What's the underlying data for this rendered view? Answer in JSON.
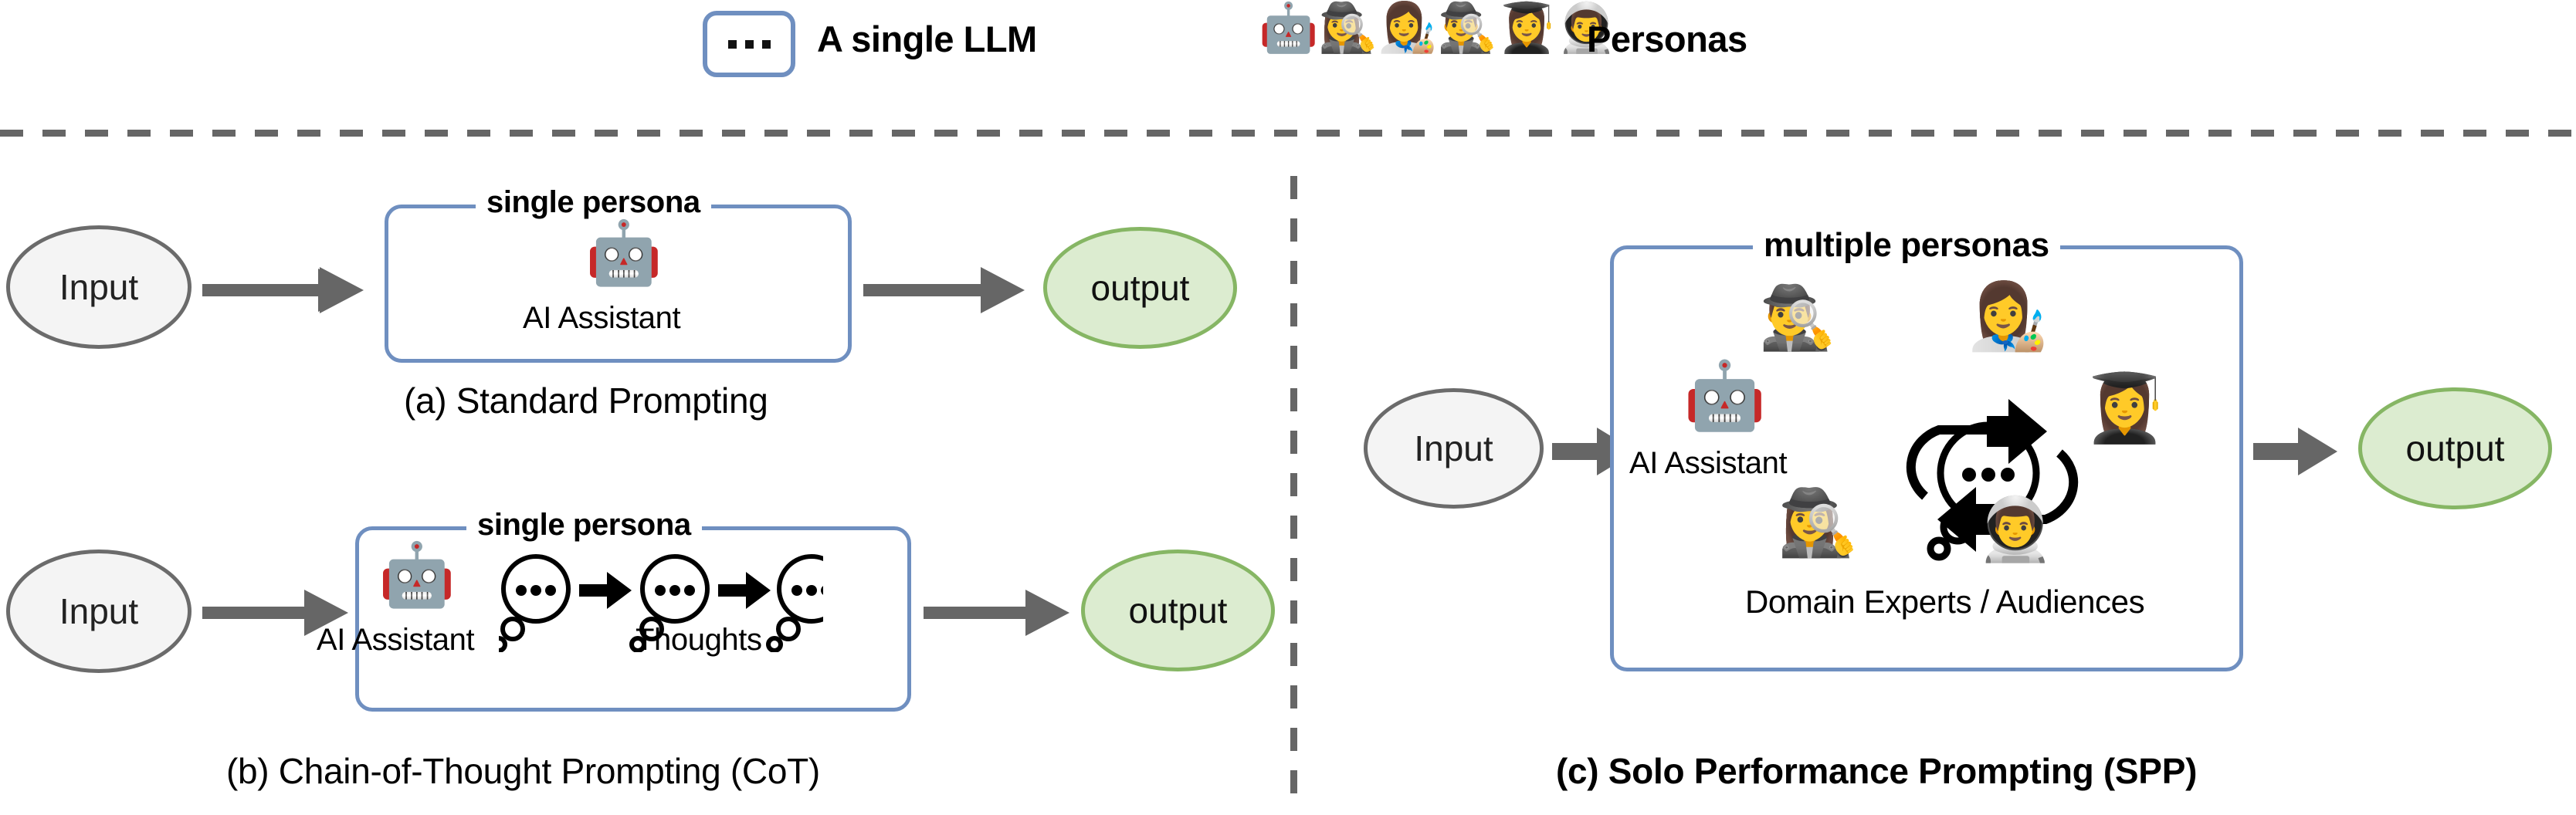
{
  "legend": {
    "llm_box_dots": "...",
    "llm_label": "A single LLM",
    "personas_label": "Personas",
    "persona_emojis": [
      "🤖",
      "🕵️‍♀️",
      "👩‍🎨",
      "🕵️‍♂️",
      "👩‍🎓",
      "👨‍🚀"
    ]
  },
  "colors": {
    "box_border_blue": "#6f8fc0",
    "input_fill": "#f4f4f4",
    "input_border": "#6b6b6b",
    "output_fill": "#dcecd0",
    "output_border": "#86b664",
    "arrow_gray": "#666666",
    "divider_gray": "#666666"
  },
  "panels": [
    {
      "id": "a",
      "caption": "(a) Standard Prompting",
      "caption_bold": false,
      "input_label": "Input",
      "output_label": "output",
      "box_title": "single persona",
      "agent_label": "AI Assistant",
      "agent_emoji": "🤖"
    },
    {
      "id": "b",
      "caption": "(b) Chain-of-Thought Prompting (CoT)",
      "caption_bold": false,
      "input_label": "Input",
      "output_label": "output",
      "box_title": "single persona",
      "agent_label": "AI Assistant",
      "agent_emoji": "🤖",
      "thoughts_label": "Thoughts",
      "thought_count": 3,
      "thought_dots": "..."
    },
    {
      "id": "c",
      "caption": "(c) Solo Performance Prompting (SPP)",
      "caption_bold": true,
      "input_label": "Input",
      "output_label": "output",
      "box_title": "multiple personas",
      "agent_label": "AI Assistant",
      "agent_emoji": "🤖",
      "experts_label": "Domain Experts / Audiences",
      "cycle_dots": "...",
      "persona_emojis": {
        "top_left": "🕵️‍♂️",
        "top_right": "👩‍🎨",
        "right": "👩‍🎓",
        "bottom_left": "🕵️‍♀️",
        "bottom_right": "👨‍🚀"
      }
    }
  ]
}
